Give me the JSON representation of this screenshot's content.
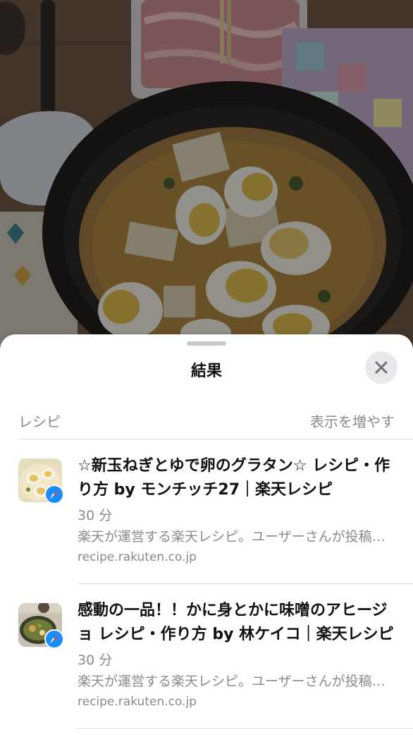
{
  "sheet": {
    "title": "結果",
    "close_icon": "close-icon"
  },
  "section": {
    "title": "レシピ",
    "show_more": "表示を増やす"
  },
  "results": [
    {
      "title": "☆新玉ねぎとゆで卵のグラタン☆ レシピ・作り方 by モンチッチ27｜楽天レシピ",
      "time": "30 分",
      "description": "楽天が運営する楽天レシピ。ユーザーさんが投稿したレシピ",
      "domain": "recipe.rakuten.co.jp",
      "badge_icon": "safari-compass-icon"
    },
    {
      "title": "感動の一品！！かに身とかに味噌のアヒージョ レシピ・作り方 by 林ケイコ｜楽天レシピ",
      "time": "30 分",
      "description": "楽天が運営する楽天レシピ。ユーザーさんが投稿したレシピ",
      "domain": "recipe.rakuten.co.jp",
      "badge_icon": "safari-compass-icon"
    }
  ],
  "colors": {
    "sheet_background": "#ffffff",
    "secondary_text": "#8a8a8e",
    "badge_blue": "#1a8cff"
  }
}
